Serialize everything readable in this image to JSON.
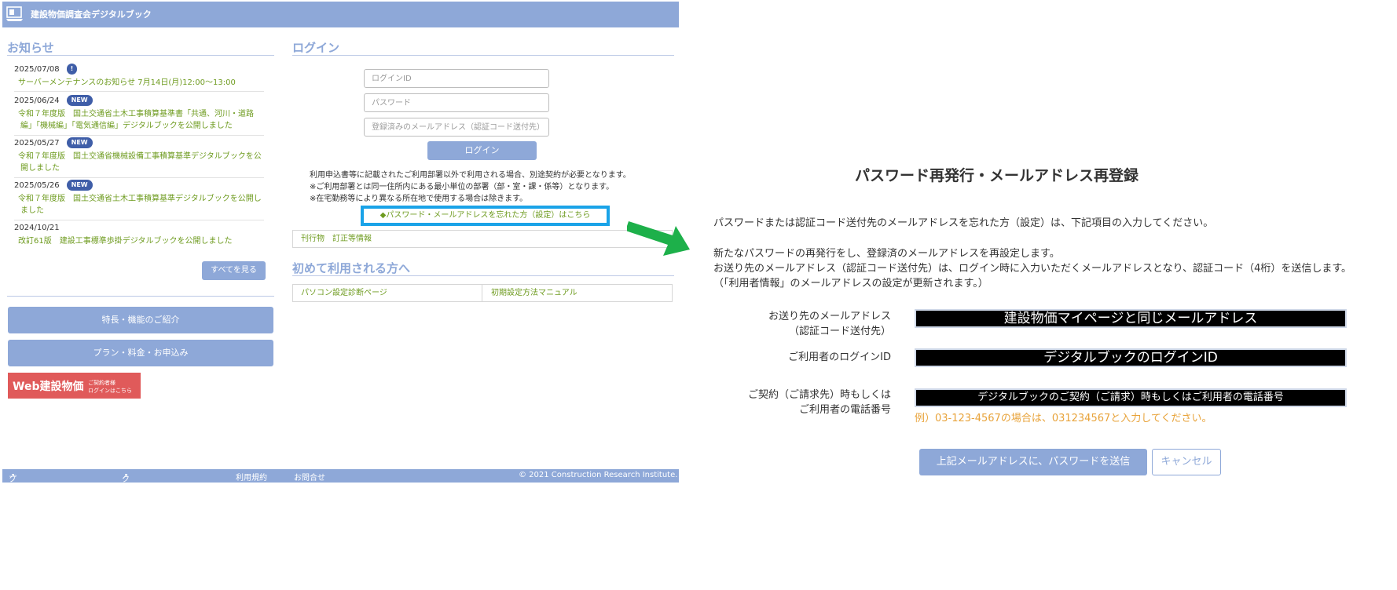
{
  "header": {
    "title": "建設物価調査会デジタルブック"
  },
  "news": {
    "title": "お知らせ",
    "items": [
      {
        "date": "2025/07/08",
        "badge": "!",
        "text": "サーバーメンテナンスのお知らせ 7月14日(月)12:00〜13:00"
      },
      {
        "date": "2025/06/24",
        "badge": "NEW",
        "text": "令和７年度版　国土交通省土木工事積算基準書「共通、河川・道路編」「機械編」「電気通信編」デジタルブックを公開しました"
      },
      {
        "date": "2025/05/27",
        "badge": "NEW",
        "text": "令和７年度版　国土交通省機械設備工事積算基準デジタルブックを公開しました"
      },
      {
        "date": "2025/05/26",
        "badge": "NEW",
        "text": "令和７年度版　国土交通省土木工事積算基準デジタルブックを公開しました"
      },
      {
        "date": "2024/10/21",
        "badge": "",
        "text": "改訂61版　建設工事標準歩掛デジタルブックを公開しました"
      }
    ],
    "see_all": "すべてを見る"
  },
  "side_buttons": {
    "features": "特長・機能のご紹介",
    "plans": "プラン・料金・お申込み"
  },
  "web_banner": {
    "main": "Web建設物価",
    "sub1": "ご契約者様",
    "sub2": "ログインはこちら"
  },
  "login": {
    "title": "ログイン",
    "id_placeholder": "ログインID",
    "password_placeholder": "パスワード",
    "email_placeholder": "登録済みのメールアドレス（認証コード送付先）",
    "button": "ログイン",
    "notes": [
      "利用申込書等に記載されたご利用部署以外で利用される場合、別途契約が必要となります。",
      "※ご利用部署とは同一住所内にある最小単位の部署（部・室・課・係等）となります。",
      "※在宅勤務等により異なる所在地で使用する場合は除きます。"
    ],
    "forgot_link": "◆パスワード・メールアドレスを忘れた方（設定）はこちら",
    "publication_link": "刊行物　訂正等情報"
  },
  "first_time": {
    "title": "初めて利用される方へ",
    "pc_check": "パソコン設定診断ページ",
    "manual": "初期設定方法マニュアル"
  },
  "footer": {
    "privacy": "プライバシーポリシー",
    "cookie": "クッキーポリシー",
    "terms": "利用規約",
    "contact": "お問合せ",
    "copyright": "© 2021 Construction Research Institute."
  },
  "reset": {
    "title": "パスワード再発行・メールアドレス再登録",
    "intro": "パスワードまたは認証コード送付先のメールアドレスを忘れた方（設定）は、下記項目の入力してください。",
    "desc1": "新たなパスワードの再発行をし、登録済のメールアドレスを再設定します。",
    "desc2": "お送り先のメールアドレス（認証コード送付先）は、ログイン時に入力いただくメールアドレスとなり、認証コード（4桁）を送信します。",
    "desc3": "（「利用者情報」のメールアドレスの設定が更新されます。）",
    "email_label_1": "お送り先のメールアドレス",
    "email_label_2": "（認証コード送付先）",
    "email_value": "建設物価マイページと同じメールアドレス",
    "login_id_label": "ご利用者のログインID",
    "login_id_value": "デジタルブックのログインID",
    "phone_label_1": "ご契約（ご請求先）時もしくは",
    "phone_label_2": "ご利用者の電話番号",
    "phone_value": "デジタルブックのご契約（ご請求）時もしくはご利用者の電話番号",
    "phone_hint": "例）03-123-4567の場合は、031234567と入力してください。",
    "submit": "上記メールアドレスに、パスワードを送信",
    "cancel": "キャンセル"
  },
  "colors": {
    "accent": "#8ea8d8",
    "link_green": "#6e9b1f",
    "highlight_blue": "#1aa3e8",
    "arrow_green": "#1db04a",
    "hint_orange": "#e8a33a"
  }
}
